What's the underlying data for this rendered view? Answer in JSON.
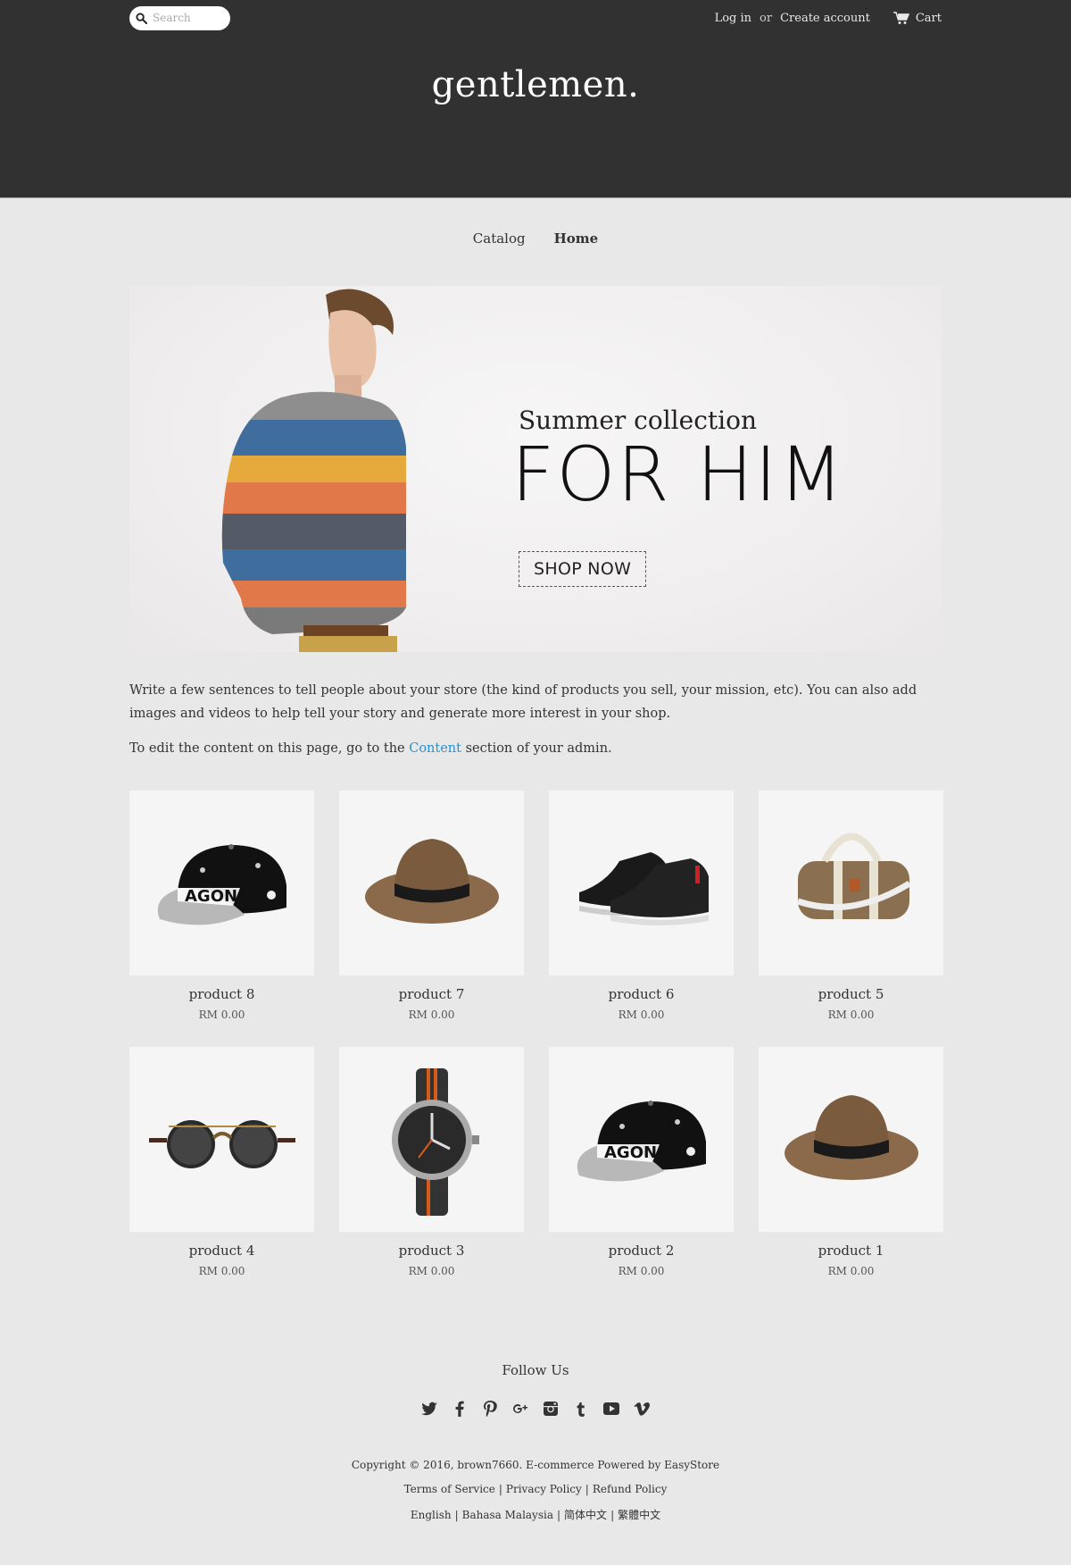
{
  "header": {
    "search_placeholder": "Search",
    "login": "Log in",
    "or": "or",
    "create_account": "Create account",
    "cart": "Cart",
    "logo": "gentlemen."
  },
  "nav": {
    "items": [
      {
        "label": "Catalog"
      },
      {
        "label": "Home"
      }
    ]
  },
  "hero": {
    "subtitle": "Summer collection",
    "title": "FOR HIM",
    "button": "SHOP NOW"
  },
  "intro": {
    "p1": "Write a few sentences to tell people about your store (the kind of products you sell, your mission, etc). You can also add images and videos to help tell your story and generate more interest in your shop.",
    "p2_before": "To edit the content on this page, go to the ",
    "p2_link": "Content",
    "p2_after": " section of your admin."
  },
  "products": [
    {
      "name": "product 8",
      "price": "RM 0.00",
      "image": "snapback-cap"
    },
    {
      "name": "product 7",
      "price": "RM 0.00",
      "image": "fedora-hat"
    },
    {
      "name": "product 6",
      "price": "RM 0.00",
      "image": "black-sneakers"
    },
    {
      "name": "product 5",
      "price": "RM 0.00",
      "image": "duffel-bag"
    },
    {
      "name": "product 4",
      "price": "RM 0.00",
      "image": "round-sunglasses"
    },
    {
      "name": "product 3",
      "price": "RM 0.00",
      "image": "wristwatch"
    },
    {
      "name": "product 2",
      "price": "RM 0.00",
      "image": "snapback-cap"
    },
    {
      "name": "product 1",
      "price": "RM 0.00",
      "image": "fedora-hat"
    }
  ],
  "footer": {
    "follow": "Follow Us",
    "social": [
      "twitter-icon",
      "facebook-icon",
      "pinterest-icon",
      "google-plus-icon",
      "instagram-icon",
      "tumblr-icon",
      "youtube-icon",
      "vimeo-icon"
    ],
    "copyright": "Copyright © 2016, brown7660. E-commerce Powered by EasyStore",
    "terms": "Terms of Service",
    "privacy": "Privacy Policy",
    "refund": "Refund Policy",
    "lang_en": "English",
    "lang_ms": "Bahasa Malaysia",
    "lang_zh_cn": "简体中文",
    "lang_zh_tw": "繁體中文",
    "separator": "|"
  },
  "colors": {
    "header_bg": "#313131",
    "page_bg": "#e8e8e8",
    "link": "#2a8fd0"
  }
}
